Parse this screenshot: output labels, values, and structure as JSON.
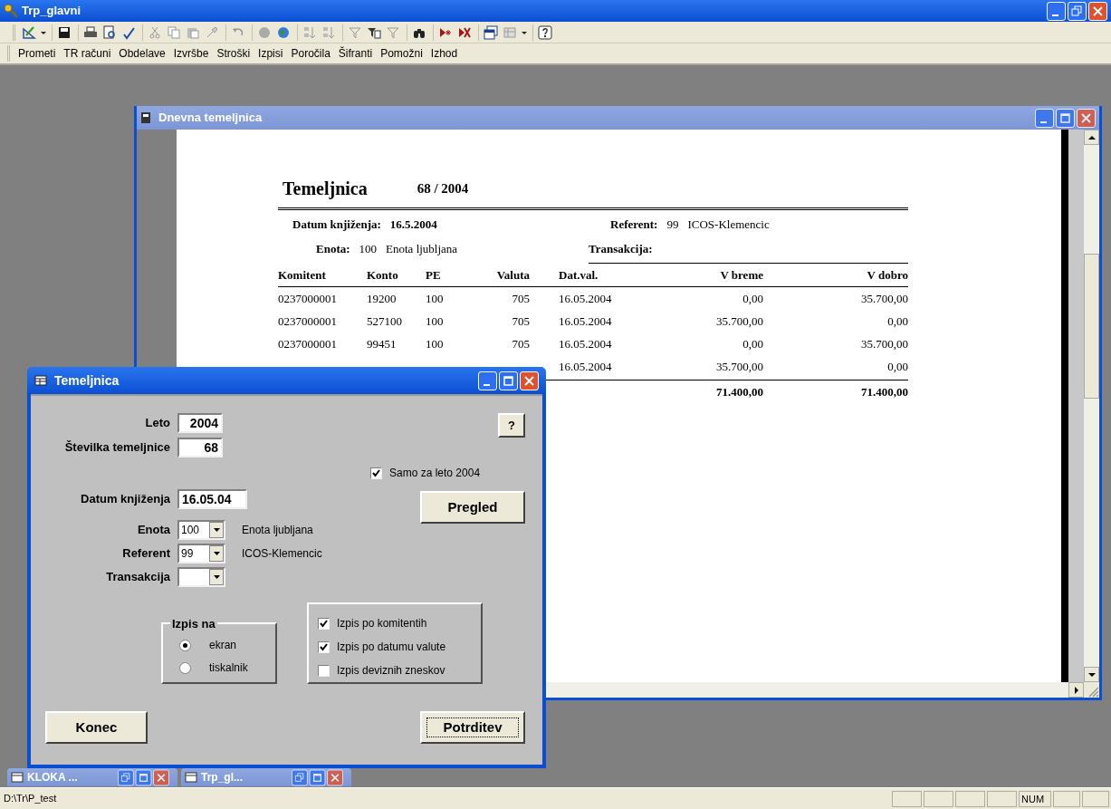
{
  "app": {
    "title": "Trp_glavni"
  },
  "menu": [
    {
      "label": "Prometi"
    },
    {
      "label": "TR računi"
    },
    {
      "label": "Obdelave"
    },
    {
      "label": "Izvršbe"
    },
    {
      "label": "Stroški"
    },
    {
      "label": "Izpisi"
    },
    {
      "label": "Poročila"
    },
    {
      "label": "Šifranti"
    },
    {
      "label": "Pomožni"
    },
    {
      "label": "Izhod"
    }
  ],
  "report_window": {
    "title": "Dnevna temeljnica",
    "report": {
      "title": "Temeljnica",
      "number": "68 / 2004",
      "info": [
        {
          "label": "Datum knjiženja:",
          "values": [
            "16.5.2004"
          ],
          "bold": true
        },
        {
          "label": "Referent:",
          "values": [
            "99",
            "ICOS-Klemencic"
          ],
          "bold": false
        },
        {
          "label": "Enota:",
          "values": [
            "100",
            "Enota ljubljana"
          ],
          "bold": false
        },
        {
          "label": "Transakcija:"
        }
      ],
      "columns": [
        "Komitent",
        "Konto",
        "PE",
        "Valuta",
        "Dat.val.",
        "V breme",
        "V dobro"
      ],
      "rows": [
        {
          "komitent": "0237000001",
          "konto": "19200",
          "pe": "100",
          "valuta": "705",
          "dat_val": "16.05.2004",
          "v_breme": "0,00",
          "v_dobro": "35.700,00"
        },
        {
          "komitent": "0237000001",
          "konto": "527100",
          "pe": "100",
          "valuta": "705",
          "dat_val": "16.05.2004",
          "v_breme": "35.700,00",
          "v_dobro": "0,00"
        },
        {
          "komitent": "0237000001",
          "konto": "99451",
          "pe": "100",
          "valuta": "705",
          "dat_val": "16.05.2004",
          "v_breme": "0,00",
          "v_dobro": "35.700,00"
        },
        {
          "dat_val": "16.05.2004",
          "v_breme": "35.700,00",
          "v_dobro": "0,00"
        }
      ],
      "totals": {
        "v_breme": "71.400,00",
        "v_dobro": "71.400,00"
      }
    }
  },
  "dialog": {
    "title": "Temeljnica",
    "text_fields": [
      {
        "label": "Leto",
        "value": "2004"
      },
      {
        "label": "Številka temeljnice",
        "value": "68"
      },
      {
        "label": "Datum knjiženja",
        "value": "16.05.04"
      }
    ],
    "combos": [
      {
        "label": "Enota",
        "value": "100",
        "description": "Enota ljubljana"
      },
      {
        "label": "Referent",
        "value": "99",
        "description": "ICOS-Klemencic"
      },
      {
        "label": "Transakcija"
      }
    ],
    "help_button": "?",
    "year_only": {
      "label": "Samo za leto 2004",
      "checked": true
    },
    "preview_button": "Pregled",
    "output_group": {
      "title": "Izpis na",
      "options": [
        {
          "label": "ekran",
          "selected": true
        },
        {
          "label": "tiskalnik",
          "selected": false
        }
      ]
    },
    "options": [
      {
        "label": "Izpis po komitentih",
        "checked": true
      },
      {
        "label": "Izpis po datumu valute",
        "checked": true
      },
      {
        "label": "Izpis deviznih zneskov",
        "checked": false
      }
    ],
    "close_button": "Konec",
    "confirm_button": {
      "label": "Potrditev",
      "focused": true
    }
  },
  "minimized_windows": [
    {
      "title": "KLOKA ..."
    },
    {
      "title": "Trp_gl..."
    }
  ],
  "status_bar": {
    "path": "D:\\Tr\\P_test",
    "indicators": [
      {
        "label": "NUM"
      }
    ]
  }
}
